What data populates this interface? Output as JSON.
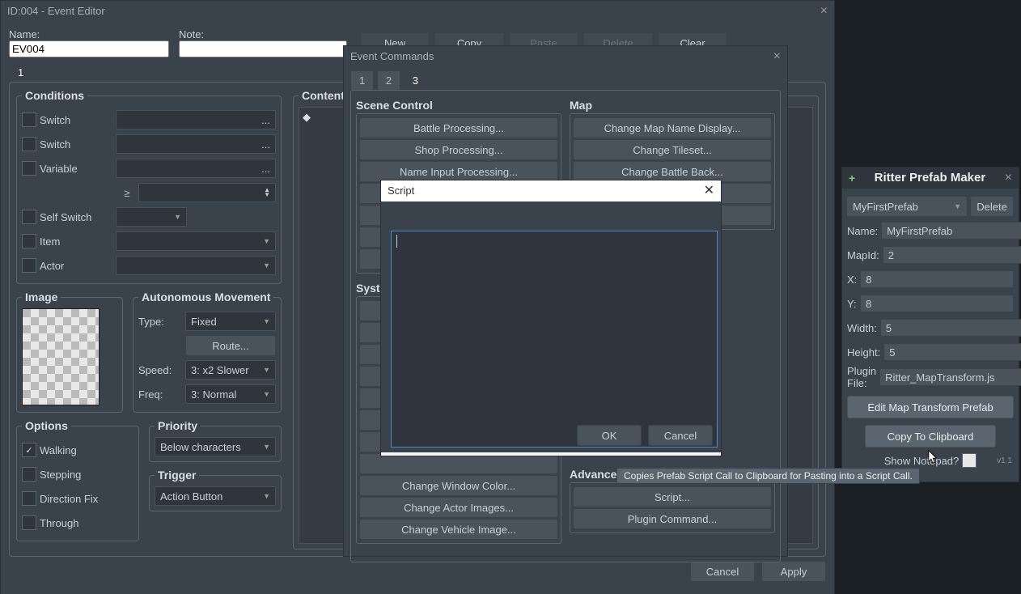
{
  "editor": {
    "title": "ID:004 - Event Editor",
    "name_label": "Name:",
    "name_value": "EV004",
    "note_label": "Note:",
    "top": {
      "new": "New",
      "copy": "Copy",
      "paste": "Paste",
      "delete": "Delete",
      "clear": "Clear"
    },
    "page_tab": "1",
    "conditions": {
      "legend": "Conditions",
      "switch": "Switch",
      "variable": "Variable",
      "gte": "≥",
      "self": "Self Switch",
      "item": "Item",
      "actor": "Actor",
      "ellipsis": "..."
    },
    "image": {
      "legend": "Image"
    },
    "move": {
      "legend": "Autonomous Movement",
      "type": "Type:",
      "type_v": "Fixed",
      "route": "Route...",
      "speed": "Speed:",
      "speed_v": "3: x2 Slower",
      "freq": "Freq:",
      "freq_v": "3: Normal"
    },
    "options": {
      "legend": "Options",
      "walking": "Walking",
      "stepping": "Stepping",
      "dirfix": "Direction Fix",
      "through": "Through",
      "walking_on": true
    },
    "priority": {
      "legend": "Priority",
      "value": "Below characters"
    },
    "trigger": {
      "legend": "Trigger",
      "value": "Action Button"
    },
    "contents": {
      "legend": "Contents"
    },
    "footer": {
      "cancel": "Cancel",
      "apply": "Apply"
    }
  },
  "commands": {
    "title": "Event Commands",
    "tabs": [
      "1",
      "2",
      "3"
    ],
    "active": 2,
    "scene": {
      "head": "Scene Control",
      "items": [
        "Battle Processing...",
        "Shop Processing...",
        "Name Input Processing..."
      ]
    },
    "map": {
      "head": "Map",
      "items": [
        "Change Map Name Display...",
        "Change Tileset...",
        "Change Battle Back..."
      ]
    },
    "system": {
      "head": "System",
      "items": [
        "Change Window Color...",
        "Change Actor Images...",
        "Change Vehicle Image..."
      ]
    },
    "adv": {
      "head": "Advanced",
      "items": [
        "Script...",
        "Plugin Command..."
      ]
    }
  },
  "script": {
    "title": "Script",
    "ok": "OK",
    "cancel": "Cancel"
  },
  "prefab": {
    "title": "Ritter Prefab Maker",
    "plus": "+",
    "close": "×",
    "select": "MyFirstPrefab",
    "delete": "Delete",
    "fields": [
      {
        "label": "Name:",
        "value": "MyFirstPrefab"
      },
      {
        "label": "MapId:",
        "value": "2"
      },
      {
        "label": "X:",
        "value": "8"
      },
      {
        "label": "Y:",
        "value": "8"
      },
      {
        "label": "Width:",
        "value": "5"
      },
      {
        "label": "Height:",
        "value": "5"
      },
      {
        "label": "Plugin File:",
        "value": "Ritter_MapTransform.js"
      }
    ],
    "edit": "Edit Map Transform Prefab",
    "copy": "Copy To Clipboard",
    "notepad": "Show Notepad?",
    "ver": "v1.1",
    "tooltip": "Copies Prefab Script Call to Clipboard for Pasting into a Script Call."
  }
}
